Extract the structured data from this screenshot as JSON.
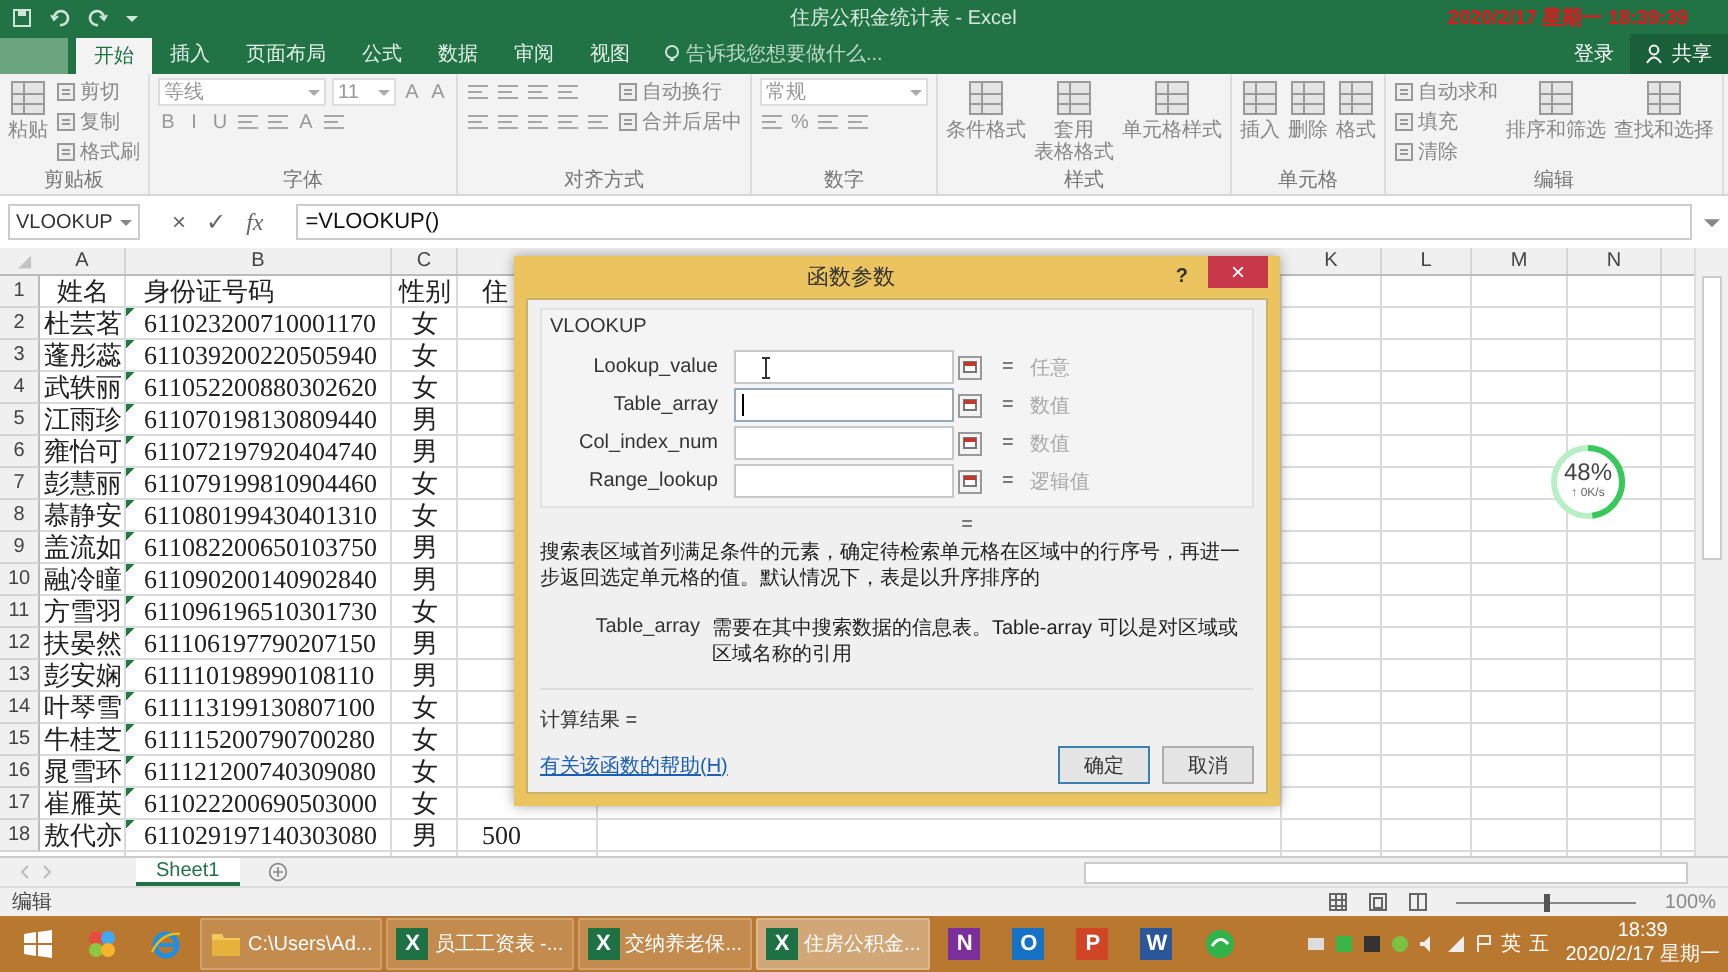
{
  "window": {
    "title": "住房公积金统计表 - Excel",
    "overlay_datetime": "2020/2/17 星期一 18:39:39"
  },
  "ribbon_tabs": [
    {
      "label": "开始",
      "selected": true
    },
    {
      "label": "插入",
      "selected": false
    },
    {
      "label": "页面布局",
      "selected": false
    },
    {
      "label": "公式",
      "selected": false
    },
    {
      "label": "数据",
      "selected": false
    },
    {
      "label": "审阅",
      "selected": false
    },
    {
      "label": "视图",
      "selected": false
    }
  ],
  "tell_me": {
    "placeholder": "告诉我您想要做什么..."
  },
  "account": {
    "sign_in": "登录",
    "share": "共享"
  },
  "ribbon_groups": [
    {
      "label": "剪贴板",
      "items": [
        {
          "kind": "large",
          "lines": [
            "粘贴"
          ]
        },
        {
          "kind": "stack",
          "rows": [
            {
              "controls": [
                {
                  "kind": "small",
                  "label": "剪切"
                }
              ]
            },
            {
              "controls": [
                {
                  "kind": "small",
                  "label": "复制"
                }
              ]
            },
            {
              "controls": [
                {
                  "kind": "small",
                  "label": "格式刷"
                }
              ]
            }
          ]
        }
      ]
    },
    {
      "label": "字体",
      "items": [
        {
          "kind": "stack",
          "rows": [
            {
              "controls": [
                {
                  "kind": "combo",
                  "value": "等线"
                },
                {
                  "kind": "spin",
                  "value": "11"
                },
                {
                  "kind": "glyph",
                  "label": "A"
                },
                {
                  "kind": "glyph",
                  "label": "A"
                }
              ]
            },
            {
              "controls": [
                {
                  "kind": "glyph",
                  "label": "B"
                },
                {
                  "kind": "glyph",
                  "label": "I"
                },
                {
                  "kind": "glyph",
                  "label": "U"
                },
                {
                  "kind": "icon"
                },
                {
                  "kind": "icon"
                },
                {
                  "kind": "glyph",
                  "label": "A"
                },
                {
                  "kind": "icon"
                }
              ]
            }
          ]
        }
      ]
    },
    {
      "label": "对齐方式",
      "items": [
        {
          "kind": "stack",
          "rows": [
            {
              "controls": [
                {
                  "kind": "icon"
                },
                {
                  "kind": "icon"
                },
                {
                  "kind": "icon"
                },
                {
                  "kind": "icon"
                }
              ]
            },
            {
              "controls": [
                {
                  "kind": "icon"
                },
                {
                  "kind": "icon"
                },
                {
                  "kind": "icon"
                },
                {
                  "kind": "icon"
                },
                {
                  "kind": "icon"
                }
              ]
            }
          ]
        },
        {
          "kind": "stack",
          "rows": [
            {
              "controls": [
                {
                  "kind": "small",
                  "label": "自动换行"
                }
              ]
            },
            {
              "controls": [
                {
                  "kind": "small",
                  "label": "合并后居中"
                }
              ]
            }
          ]
        }
      ]
    },
    {
      "label": "数字",
      "items": [
        {
          "kind": "stack",
          "rows": [
            {
              "controls": [
                {
                  "kind": "combo",
                  "value": "常规"
                }
              ]
            },
            {
              "controls": [
                {
                  "kind": "icon"
                },
                {
                  "kind": "glyph",
                  "label": "%"
                },
                {
                  "kind": "icon"
                },
                {
                  "kind": "icon"
                }
              ]
            }
          ]
        }
      ]
    },
    {
      "label": "样式",
      "items": [
        {
          "kind": "large",
          "lines": [
            "条件格式"
          ]
        },
        {
          "kind": "large",
          "lines": [
            "套用",
            "表格格式"
          ]
        },
        {
          "kind": "large",
          "lines": [
            "单元格样式"
          ]
        }
      ]
    },
    {
      "label": "单元格",
      "items": [
        {
          "kind": "large",
          "lines": [
            "插入"
          ]
        },
        {
          "kind": "large",
          "lines": [
            "删除"
          ]
        },
        {
          "kind": "large",
          "lines": [
            "格式"
          ]
        }
      ]
    },
    {
      "label": "编辑",
      "items": [
        {
          "kind": "stack",
          "rows": [
            {
              "controls": [
                {
                  "kind": "small",
                  "label": "自动求和"
                }
              ]
            },
            {
              "controls": [
                {
                  "kind": "small",
                  "label": "填充"
                }
              ]
            },
            {
              "controls": [
                {
                  "kind": "small",
                  "label": "清除"
                }
              ]
            }
          ]
        },
        {
          "kind": "large",
          "lines": [
            "排序和筛选"
          ]
        },
        {
          "kind": "large",
          "lines": [
            "查找和选择"
          ]
        }
      ]
    }
  ],
  "formula_bar": {
    "name_box": "VLOOKUP",
    "cancel": "×",
    "enter": "✓",
    "fx": "fx",
    "formula": "=VLOOKUP()"
  },
  "columns": [
    "A",
    "B",
    "C",
    "K",
    "L",
    "M",
    "N"
  ],
  "rows": [
    {
      "number": "1",
      "name": "姓名",
      "id": "身份证号码",
      "gender": "性别",
      "column_4": "住",
      "flagged": false
    },
    {
      "number": "2",
      "name": "杜芸茗",
      "id": "611023200710001170",
      "gender": "女",
      "flagged": true
    },
    {
      "number": "3",
      "name": "蓬彤蕊",
      "id": "611039200220505940",
      "gender": "女",
      "flagged": true
    },
    {
      "number": "4",
      "name": "武轶丽",
      "id": "611052200880302620",
      "gender": "女",
      "flagged": true
    },
    {
      "number": "5",
      "name": "江雨珍",
      "id": "611070198130809440",
      "gender": "男",
      "flagged": true
    },
    {
      "number": "6",
      "name": "雍怡可",
      "id": "611072197920404740",
      "gender": "男",
      "flagged": true
    },
    {
      "number": "7",
      "name": "彭慧丽",
      "id": "611079199810904460",
      "gender": "女",
      "flagged": true
    },
    {
      "number": "8",
      "name": "慕静安",
      "id": "611080199430401310",
      "gender": "女",
      "flagged": true
    },
    {
      "number": "9",
      "name": "盖流如",
      "id": "611082200650103750",
      "gender": "男",
      "flagged": true
    },
    {
      "number": "10",
      "name": "融冷瞳",
      "id": "611090200140902840",
      "gender": "男",
      "flagged": true
    },
    {
      "number": "11",
      "name": "方雪羽",
      "id": "611096196510301730",
      "gender": "女",
      "flagged": true
    },
    {
      "number": "12",
      "name": "扶晏然",
      "id": "611106197790207150",
      "gender": "男",
      "flagged": true
    },
    {
      "number": "13",
      "name": "彭安娴",
      "id": "611110198990108110",
      "gender": "男",
      "flagged": true
    },
    {
      "number": "14",
      "name": "叶琴雪",
      "id": "611113199130807100",
      "gender": "女",
      "flagged": true
    },
    {
      "number": "15",
      "name": "牛桂芝",
      "id": "611115200790700280",
      "gender": "女",
      "flagged": true
    },
    {
      "number": "16",
      "name": "晁雪环",
      "id": "611121200740309080",
      "gender": "女",
      "flagged": true
    },
    {
      "number": "17",
      "name": "崔雁英",
      "id": "611022200690503000",
      "gender": "女",
      "flagged": true
    },
    {
      "number": "18",
      "name": "敖代亦",
      "id": "611029197140303080",
      "gender": "男",
      "column_4": "500",
      "flagged": true
    }
  ],
  "sheet_tabs": [
    {
      "label": "Sheet1",
      "selected": true
    }
  ],
  "status_bar": {
    "mode": "编辑",
    "zoom": "100%",
    "level": 0.5
  },
  "dialog": {
    "title": "函数参数",
    "help": "?",
    "close": "×",
    "function": "VLOOKUP",
    "args": [
      {
        "name": "Lookup_value",
        "equals": "=",
        "hint": "任意",
        "focused": false,
        "pointer": true
      },
      {
        "name": "Table_array",
        "equals": "=",
        "hint": "数值",
        "focused": true,
        "pointer": false
      },
      {
        "name": "Col_index_num",
        "equals": "=",
        "hint": "数值",
        "focused": false,
        "pointer": false
      },
      {
        "name": "Range_lookup",
        "equals": "=",
        "hint": "逻辑值",
        "focused": false,
        "pointer": false
      }
    ],
    "result_equals": "=",
    "description": "搜索表区域首列满足条件的元素，确定待检索单元格在区域中的行序号，再进一步返回选定单元格的值。默认情况下，表是以升序排序的",
    "arg_name": "Table_array",
    "arg_description": "需要在其中搜索数据的信息表。Table-array 可以是对区域或区域名称的引用",
    "result_label": "计算结果 =",
    "help_link": "有关该函数的帮助(H)",
    "buttons": [
      {
        "label": "确定",
        "default": true
      },
      {
        "label": "取消",
        "default": false
      }
    ]
  },
  "monitor_widget": {
    "percent": "48%",
    "speed": "↑ 0K/s",
    "level": 0.48
  },
  "taskbar": {
    "items": [
      {
        "kind": "start",
        "selected": false
      },
      {
        "kind": "blobs",
        "selected": false
      },
      {
        "kind": "browser",
        "selected": false
      },
      {
        "kind": "folder",
        "label": "C:\\Users\\Ad...",
        "selected": false
      },
      {
        "kind": "letter",
        "letter": "X",
        "color": "#1e7145",
        "label": "员工工资表 -...",
        "selected": false
      },
      {
        "kind": "letter",
        "letter": "X",
        "color": "#1e7145",
        "label": "交纳养老保...",
        "selected": false
      },
      {
        "kind": "letter",
        "letter": "X",
        "color": "#1e7145",
        "label": "住房公积金...",
        "selected": true
      },
      {
        "kind": "letter",
        "letter": "N",
        "color": "#7b2f9a",
        "selected": false
      },
      {
        "kind": "letter",
        "letter": "O",
        "color": "#1672c4",
        "selected": false
      },
      {
        "kind": "letter",
        "letter": "P",
        "color": "#d04526",
        "selected": false
      },
      {
        "kind": "letter",
        "letter": "W",
        "color": "#2b579a",
        "selected": false
      },
      {
        "kind": "green",
        "selected": false
      }
    ],
    "ime": [
      "英",
      "五"
    ],
    "time": "18:39",
    "date": "2020/2/17 星期一"
  }
}
